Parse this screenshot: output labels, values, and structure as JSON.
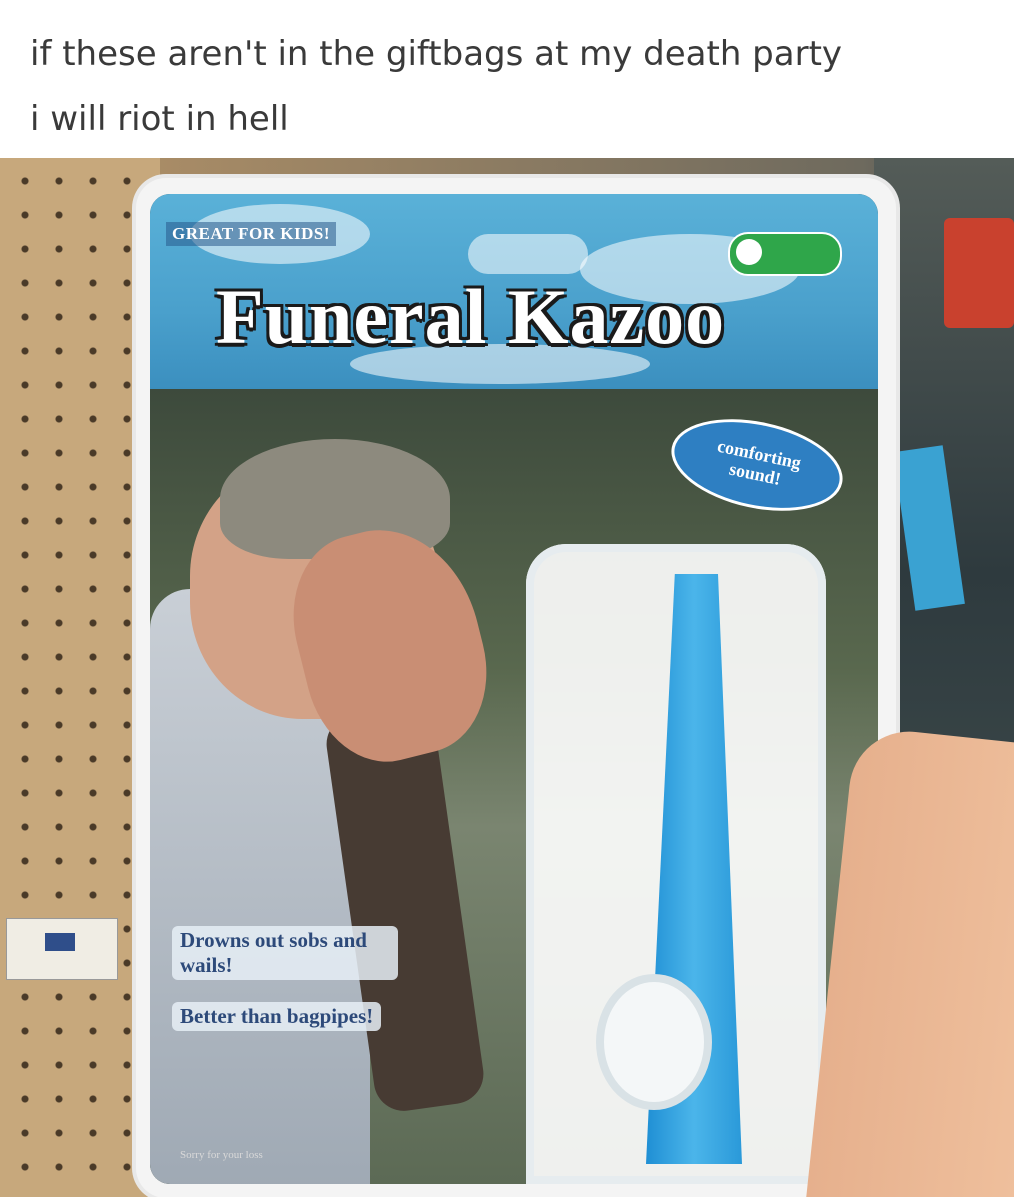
{
  "caption": {
    "line1": "if these aren't in the giftbags at my death party",
    "line2": "i will riot in hell"
  },
  "product": {
    "top_label": "GREAT FOR KIDS!",
    "name": "Funeral Kazoo",
    "sticker_line1": "comforting",
    "sticker_line2": "sound!",
    "bullet1": "Drowns out sobs and wails!",
    "bullet2": "Better than bagpipes!",
    "fine_print": "Sorry for your loss"
  },
  "colors": {
    "banner": "#4aa0cc",
    "kazoo": "#2a99d9",
    "sticker": "#2e7fc2"
  }
}
